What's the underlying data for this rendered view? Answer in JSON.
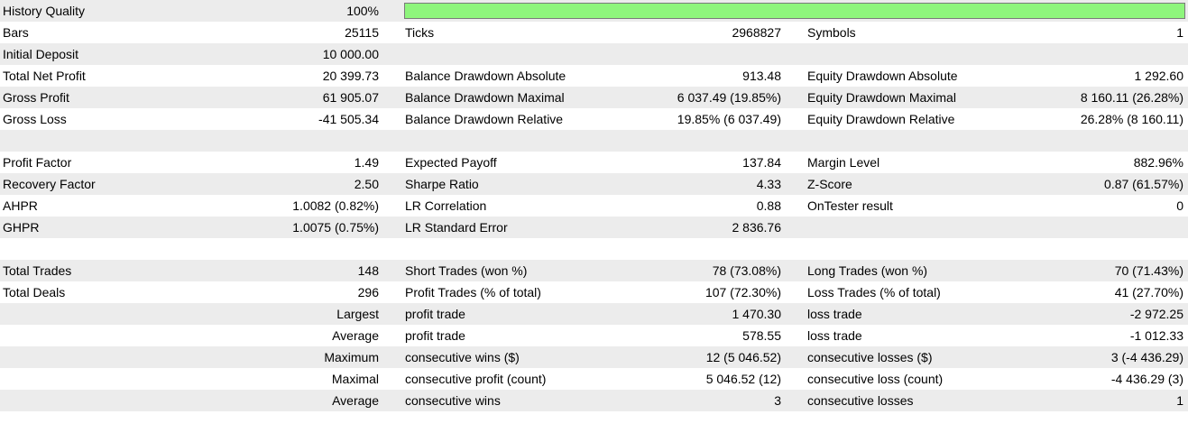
{
  "colors": {
    "row_alt": "#ececec",
    "quality_fill": "#8ef57c"
  },
  "history_quality": {
    "label": "History Quality",
    "value": "100%",
    "fill_fraction": 1.0
  },
  "rows": [
    {
      "c1": "Bars",
      "c2": "25115",
      "c3": "Ticks",
      "c4": "2968827",
      "c5": "Symbols",
      "c6": "1"
    },
    {
      "c1": "Initial Deposit",
      "c2": "10 000.00",
      "c3": "",
      "c4": "",
      "c5": "",
      "c6": ""
    },
    {
      "c1": "Total Net Profit",
      "c2": "20 399.73",
      "c3": "Balance Drawdown Absolute",
      "c4": "913.48",
      "c5": "Equity Drawdown Absolute",
      "c6": "1 292.60"
    },
    {
      "c1": "Gross Profit",
      "c2": "61 905.07",
      "c3": "Balance Drawdown Maximal",
      "c4": "6 037.49 (19.85%)",
      "c5": "Equity Drawdown Maximal",
      "c6": "8 160.11 (26.28%)"
    },
    {
      "c1": "Gross Loss",
      "c2": "-41 505.34",
      "c3": "Balance Drawdown Relative",
      "c4": "19.85% (6 037.49)",
      "c5": "Equity Drawdown Relative",
      "c6": "26.28% (8 160.11)"
    },
    {
      "c1": "",
      "c2": "",
      "c3": "",
      "c4": "",
      "c5": "",
      "c6": ""
    },
    {
      "c1": "Profit Factor",
      "c2": "1.49",
      "c3": "Expected Payoff",
      "c4": "137.84",
      "c5": "Margin Level",
      "c6": "882.96%"
    },
    {
      "c1": "Recovery Factor",
      "c2": "2.50",
      "c3": "Sharpe Ratio",
      "c4": "4.33",
      "c5": "Z-Score",
      "c6": "0.87 (61.57%)"
    },
    {
      "c1": "AHPR",
      "c2": "1.0082 (0.82%)",
      "c3": "LR Correlation",
      "c4": "0.88",
      "c5": "OnTester result",
      "c6": "0"
    },
    {
      "c1": "GHPR",
      "c2": "1.0075 (0.75%)",
      "c3": "LR Standard Error",
      "c4": "2 836.76",
      "c5": "",
      "c6": ""
    },
    {
      "c1": "",
      "c2": "",
      "c3": "",
      "c4": "",
      "c5": "",
      "c6": ""
    },
    {
      "c1": "Total Trades",
      "c2": "148",
      "c3": "Short Trades (won %)",
      "c4": "78 (73.08%)",
      "c5": "Long Trades (won %)",
      "c6": "70 (71.43%)"
    },
    {
      "c1": "Total Deals",
      "c2": "296",
      "c3": "Profit Trades (% of total)",
      "c4": "107 (72.30%)",
      "c5": "Loss Trades (% of total)",
      "c6": "41 (27.70%)"
    },
    {
      "c1": "",
      "c2": "Largest",
      "c3": "profit trade",
      "c4": "1 470.30",
      "c5": "loss trade",
      "c6": "-2 972.25"
    },
    {
      "c1": "",
      "c2": "Average",
      "c3": "profit trade",
      "c4": "578.55",
      "c5": "loss trade",
      "c6": "-1 012.33"
    },
    {
      "c1": "",
      "c2": "Maximum",
      "c3": "consecutive wins ($)",
      "c4": "12 (5 046.52)",
      "c5": "consecutive losses ($)",
      "c6": "3 (-4 436.29)"
    },
    {
      "c1": "",
      "c2": "Maximal",
      "c3": "consecutive profit (count)",
      "c4": "5 046.52 (12)",
      "c5": "consecutive loss (count)",
      "c6": "-4 436.29 (3)"
    },
    {
      "c1": "",
      "c2": "Average",
      "c3": "consecutive wins",
      "c4": "3",
      "c5": "consecutive losses",
      "c6": "1"
    },
    {
      "c1": "",
      "c2": "",
      "c3": "",
      "c4": "",
      "c5": "",
      "c6": ""
    }
  ]
}
